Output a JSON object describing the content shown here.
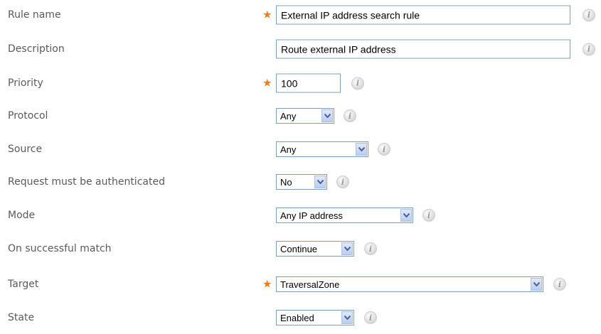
{
  "form": {
    "required_marker": "★",
    "info_glyph": "i",
    "fields": {
      "rule_name": {
        "label": "Rule name",
        "value": "External IP address search rule"
      },
      "description": {
        "label": "Description",
        "value": "Route external IP address"
      },
      "priority": {
        "label": "Priority",
        "value": "100"
      },
      "protocol": {
        "label": "Protocol",
        "value": "Any"
      },
      "source": {
        "label": "Source",
        "value": "Any"
      },
      "authenticated": {
        "label": "Request must be authenticated",
        "value": "No"
      },
      "mode": {
        "label": "Mode",
        "value": "Any IP address"
      },
      "on_match": {
        "label": "On successful match",
        "value": "Continue"
      },
      "target": {
        "label": "Target",
        "value": "TraversalZone"
      },
      "state": {
        "label": "State",
        "value": "Enabled"
      }
    }
  },
  "colors": {
    "required_marker": "#f27a1a",
    "field_border": "#7f9db9",
    "label_text": "#5a5a5a"
  },
  "icons": {
    "info": "info-icon",
    "dropdown": "chevron-down-icon"
  }
}
